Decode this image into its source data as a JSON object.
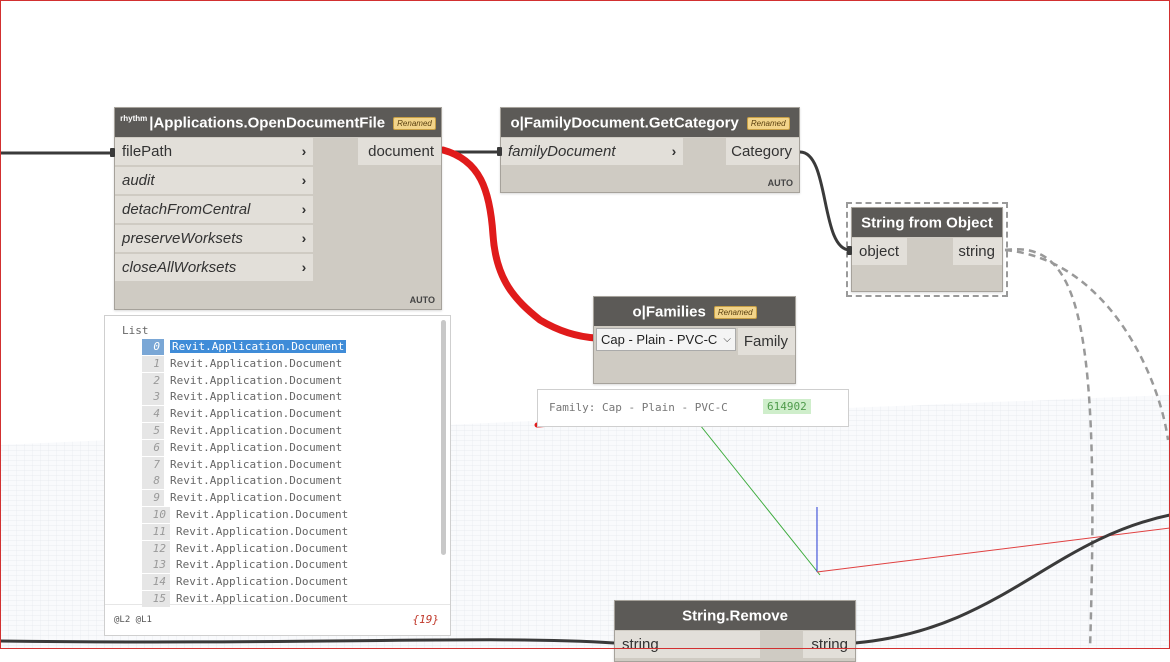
{
  "nodes": {
    "open_doc": {
      "prefix": "rhythm",
      "title": "|Applications.OpenDocumentFile",
      "badge": "Renamed",
      "inputs": [
        "filePath",
        "audit",
        "detachFromCentral",
        "preserveWorksets",
        "closeAllWorksets"
      ],
      "output": "document",
      "lacing": "AUTO"
    },
    "get_category": {
      "title": "o|FamilyDocument.GetCategory",
      "badge": "Renamed",
      "input": "familyDocument",
      "output": "Category",
      "lacing": "AUTO"
    },
    "string_from_object": {
      "title": "String from Object",
      "input": "object",
      "output": "string"
    },
    "families": {
      "title": "o|Families",
      "badge": "Renamed",
      "selected": "Cap - Plain - PVC-C",
      "output": "Family"
    },
    "string_remove": {
      "title": "String.Remove",
      "input": "string",
      "output": "string"
    }
  },
  "families_preview": {
    "text": "Family: Cap - Plain - PVC-C",
    "id": "614902"
  },
  "watch": {
    "title": "List",
    "items": [
      {
        "index": "0",
        "value": "Revit.Application.Document"
      },
      {
        "index": "1",
        "value": "Revit.Application.Document"
      },
      {
        "index": "2",
        "value": "Revit.Application.Document"
      },
      {
        "index": "3",
        "value": "Revit.Application.Document"
      },
      {
        "index": "4",
        "value": "Revit.Application.Document"
      },
      {
        "index": "5",
        "value": "Revit.Application.Document"
      },
      {
        "index": "6",
        "value": "Revit.Application.Document"
      },
      {
        "index": "7",
        "value": "Revit.Application.Document"
      },
      {
        "index": "8",
        "value": "Revit.Application.Document"
      },
      {
        "index": "9",
        "value": "Revit.Application.Document"
      },
      {
        "index": "10",
        "value": "Revit.Application.Document"
      },
      {
        "index": "11",
        "value": "Revit.Application.Document"
      },
      {
        "index": "12",
        "value": "Revit.Application.Document"
      },
      {
        "index": "13",
        "value": "Revit.Application.Document"
      },
      {
        "index": "14",
        "value": "Revit.Application.Document"
      },
      {
        "index": "15",
        "value": "Revit.Application.Document"
      }
    ],
    "levels": "@L2 @L1",
    "count": "{19}"
  },
  "colors": {
    "node_header": "#5c5a57",
    "node_body": "#cfcbc3",
    "badge": "#f2d48a",
    "highlight_annotation": "#e01b1b",
    "selected_item": "#3f8cd8",
    "id_chip": "#cfeecb"
  }
}
